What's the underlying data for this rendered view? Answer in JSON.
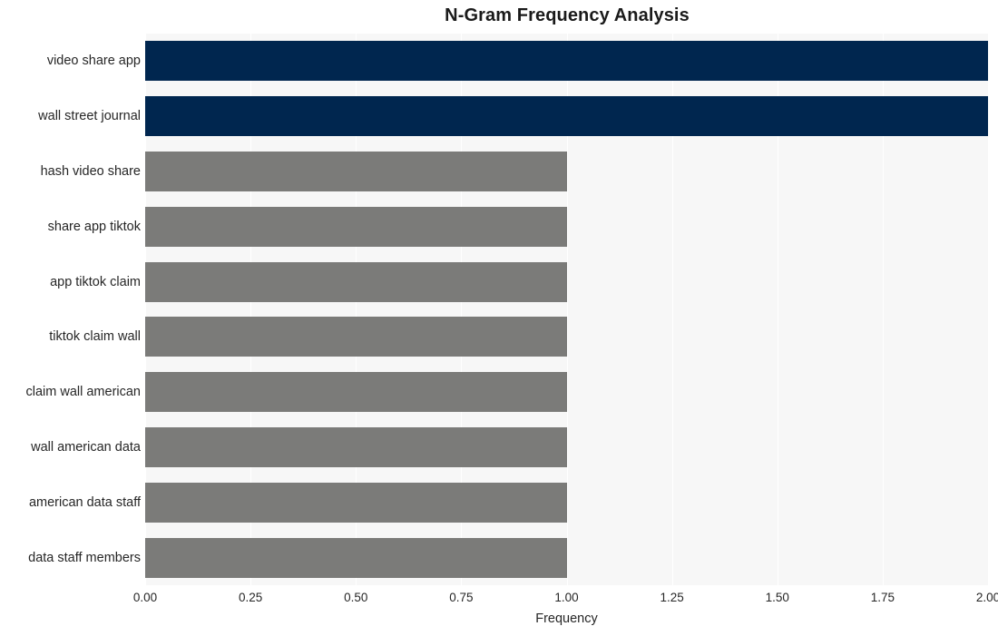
{
  "chart_data": {
    "type": "bar",
    "orientation": "horizontal",
    "title": "N-Gram Frequency Analysis",
    "xlabel": "Frequency",
    "ylabel": "",
    "categories": [
      "video share app",
      "wall street journal",
      "hash video share",
      "share app tiktok",
      "app tiktok claim",
      "tiktok claim wall",
      "claim wall american",
      "wall american data",
      "american data staff",
      "data staff members"
    ],
    "values": [
      2,
      2,
      1,
      1,
      1,
      1,
      1,
      1,
      1,
      1
    ],
    "bar_colors": [
      "#00264f",
      "#00264f",
      "#7b7b79",
      "#7b7b79",
      "#7b7b79",
      "#7b7b79",
      "#7b7b79",
      "#7b7b79",
      "#7b7b79",
      "#7b7b79"
    ],
    "xlim": [
      0,
      2.0
    ],
    "xticks": [
      0.0,
      0.25,
      0.5,
      0.75,
      1.0,
      1.25,
      1.5,
      1.75,
      2.0
    ],
    "xtick_labels": [
      "0.00",
      "0.25",
      "0.50",
      "0.75",
      "1.00",
      "1.25",
      "1.50",
      "1.75",
      "2.00"
    ],
    "grid": true,
    "grid_axis": "x",
    "grid_color": "#ffffff",
    "legend": null,
    "plot_background": "#f7f7f7",
    "figure_background": "#ffffff",
    "highlight_color": "#00264f",
    "default_color": "#7b7b79"
  }
}
